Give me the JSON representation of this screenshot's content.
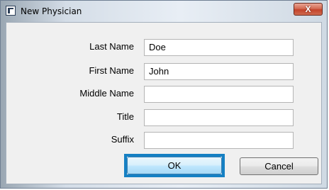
{
  "window": {
    "title": "New Physician",
    "close_symbol": "X",
    "icon": "app-window-icon",
    "accent_focus_color": "#1580c3"
  },
  "form": {
    "fields": [
      {
        "label": "Last Name",
        "value": "Doe"
      },
      {
        "label": "First Name",
        "value": "John"
      },
      {
        "label": "Middle Name",
        "value": ""
      },
      {
        "label": "Title",
        "value": ""
      },
      {
        "label": "Suffix",
        "value": ""
      }
    ]
  },
  "buttons": {
    "ok_label": "OK",
    "cancel_label": "Cancel"
  }
}
